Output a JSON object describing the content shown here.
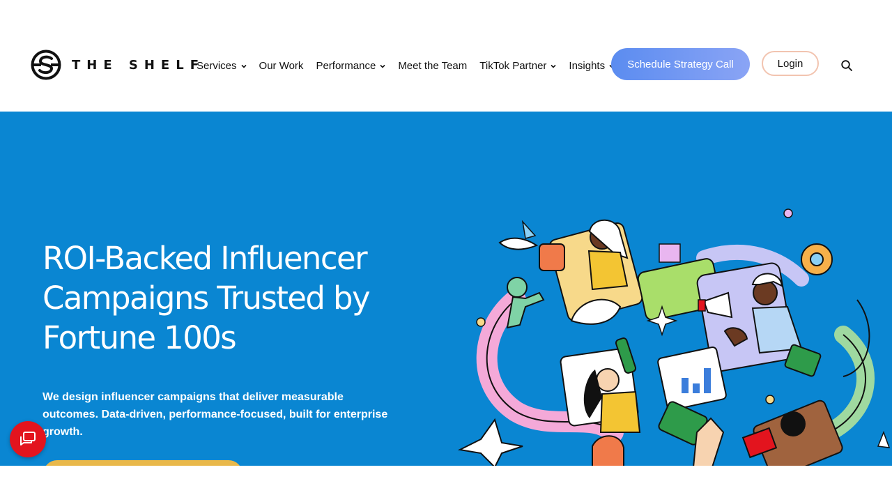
{
  "brand": {
    "name": "THE SHELF"
  },
  "nav": {
    "items": [
      {
        "label": "Services",
        "dropdown": true
      },
      {
        "label": "Our Work",
        "dropdown": false
      },
      {
        "label": "Performance",
        "dropdown": true
      },
      {
        "label": "Meet the Team",
        "dropdown": false
      },
      {
        "label": "TikTok Partner",
        "dropdown": true
      },
      {
        "label": "Insights",
        "dropdown": true
      }
    ],
    "cta_label": "Schedule Strategy Call",
    "login_label": "Login",
    "search_icon": "search-icon"
  },
  "hero": {
    "title_lines": [
      "ROI-Backed Influencer",
      "Campaigns Trusted by",
      "Fortune 100s"
    ],
    "subtitle_lines": [
      "We design influencer campaigns that deliver measurable",
      "outcomes. Data-driven, performance-focused, built for enterprise",
      "growth."
    ],
    "illustration": "influencer-collage-illustration"
  },
  "chat": {
    "icon": "chat-bubbles-icon"
  },
  "colors": {
    "hero_bg": "#0a86d2",
    "cta_gradient_start": "#5b8cf0",
    "cta_gradient_end": "#8aa4f5",
    "login_border": "#f2c4b0",
    "chat_bg": "#e3141e",
    "hero_button": "#e9b84a"
  }
}
